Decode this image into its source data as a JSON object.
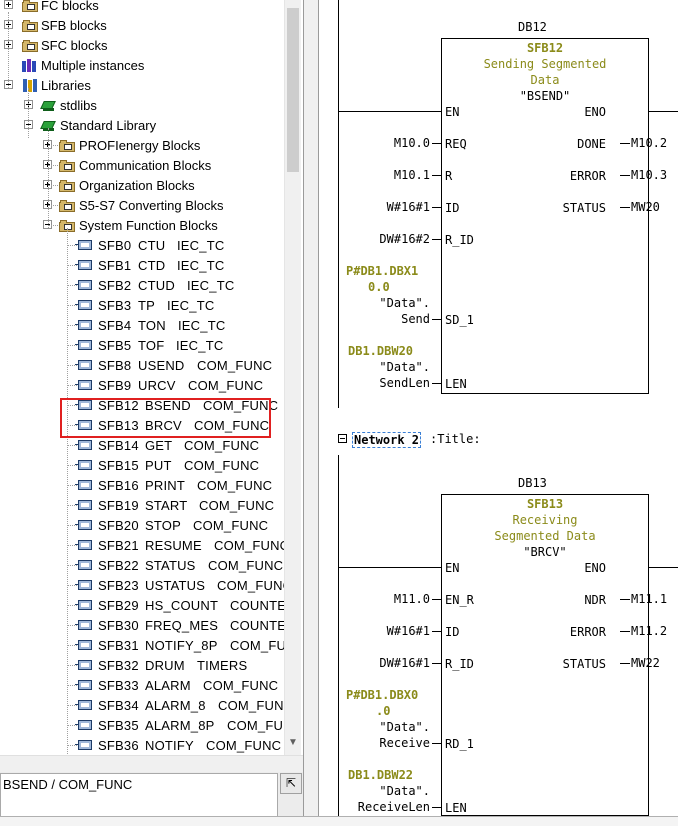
{
  "tree": {
    "folders_top": [
      "FC blocks",
      "SFB blocks",
      "SFC blocks",
      "Multiple instances",
      "Libraries"
    ],
    "libraries": [
      "stdlibs",
      "Standard Library"
    ],
    "std_sub": [
      "PROFIenergy Blocks",
      "Communication Blocks",
      "Organization Blocks",
      "S5-S7 Converting Blocks",
      "System Function Blocks"
    ],
    "sfbs": [
      {
        "id": "SFB0",
        "name": "CTU",
        "family": "IEC_TC"
      },
      {
        "id": "SFB1",
        "name": "CTD",
        "family": "IEC_TC"
      },
      {
        "id": "SFB2",
        "name": "CTUD",
        "family": "IEC_TC"
      },
      {
        "id": "SFB3",
        "name": "TP",
        "family": "IEC_TC"
      },
      {
        "id": "SFB4",
        "name": "TON",
        "family": "IEC_TC"
      },
      {
        "id": "SFB5",
        "name": "TOF",
        "family": "IEC_TC"
      },
      {
        "id": "SFB8",
        "name": "USEND",
        "family": "COM_FUNC"
      },
      {
        "id": "SFB9",
        "name": "URCV",
        "family": "COM_FUNC"
      },
      {
        "id": "SFB12",
        "name": "BSEND",
        "family": "COM_FUNC"
      },
      {
        "id": "SFB13",
        "name": "BRCV",
        "family": "COM_FUNC"
      },
      {
        "id": "SFB14",
        "name": "GET",
        "family": "COM_FUNC"
      },
      {
        "id": "SFB15",
        "name": "PUT",
        "family": "COM_FUNC"
      },
      {
        "id": "SFB16",
        "name": "PRINT",
        "family": "COM_FUNC"
      },
      {
        "id": "SFB19",
        "name": "START",
        "family": "COM_FUNC"
      },
      {
        "id": "SFB20",
        "name": "STOP",
        "family": "COM_FUNC"
      },
      {
        "id": "SFB21",
        "name": "RESUME",
        "family": "COM_FUNC"
      },
      {
        "id": "SFB22",
        "name": "STATUS",
        "family": "COM_FUNC"
      },
      {
        "id": "SFB23",
        "name": "USTATUS",
        "family": "COM_FUNC"
      },
      {
        "id": "SFB29",
        "name": "HS_COUNT",
        "family": "COUNTER"
      },
      {
        "id": "SFB30",
        "name": "FREQ_MES",
        "family": "COUNTERS"
      },
      {
        "id": "SFB31",
        "name": "NOTIFY_8P",
        "family": "COM_FUNC"
      },
      {
        "id": "SFB32",
        "name": "DRUM",
        "family": "TIMERS"
      },
      {
        "id": "SFB33",
        "name": "ALARM",
        "family": "COM_FUNC"
      },
      {
        "id": "SFB34",
        "name": "ALARM_8",
        "family": "COM_FUNC"
      },
      {
        "id": "SFB35",
        "name": "ALARM_8P",
        "family": "COM_FUNC"
      },
      {
        "id": "SFB36",
        "name": "NOTIFY",
        "family": "COM_FUNC"
      }
    ]
  },
  "status": {
    "text": "BSEND / COM_FUNC",
    "button": "⇱"
  },
  "icons": {
    "folder": "folder-icon",
    "block": "block-icon",
    "library": "library-icon",
    "book": "book-icon",
    "multi": "multiple-instances-icon"
  },
  "colors": {
    "highlight": "#e02020",
    "sfb_text": "#8b8b1a",
    "network_focus": "#3a7fd5"
  },
  "network1": {
    "db": "DB12",
    "sfb": "SFB12",
    "desc1": "Sending Segmented",
    "desc2": "Data",
    "symbol": "\"BSEND\"",
    "in_pins": [
      "EN",
      "REQ",
      "R",
      "ID",
      "R_ID",
      "SD_1",
      "LEN"
    ],
    "out_pins": [
      "ENO",
      "DONE",
      "ERROR",
      "STATUS"
    ],
    "in_ops": [
      "",
      "M10.0",
      "M10.1",
      "W#16#1",
      "DW#16#2"
    ],
    "out_ops": [
      "M10.2",
      "M10.3",
      "MW20"
    ],
    "sd_ptr1": "P#DB1.DBX1",
    "sd_ptr2": "0.0",
    "sd_sym": "\"Data\".",
    "sd_name": "Send",
    "len_ptr": "DB1.DBW20",
    "len_sym": "\"Data\".",
    "len_name": "SendLen"
  },
  "network2_header": {
    "label": "Network 2",
    "title": ":Title:"
  },
  "network2": {
    "db": "DB13",
    "sfb": "SFB13",
    "desc1": "Receiving",
    "desc2": "Segmented Data",
    "symbol": "\"BRCV\"",
    "in_pins": [
      "EN",
      "EN_R",
      "ID",
      "R_ID",
      "RD_1",
      "LEN"
    ],
    "out_pins": [
      "ENO",
      "NDR",
      "ERROR",
      "STATUS"
    ],
    "in_ops": [
      "M11.0",
      "W#16#1",
      "DW#16#1"
    ],
    "out_ops": [
      "M11.1",
      "M11.2",
      "MW22"
    ],
    "rd_ptr1": "P#DB1.DBX0",
    "rd_ptr2": ".0",
    "rd_sym": "\"Data\".",
    "rd_name": "Receive",
    "len_ptr": "DB1.DBW22",
    "len_sym": "\"Data\".",
    "len_name": "ReceiveLen"
  }
}
